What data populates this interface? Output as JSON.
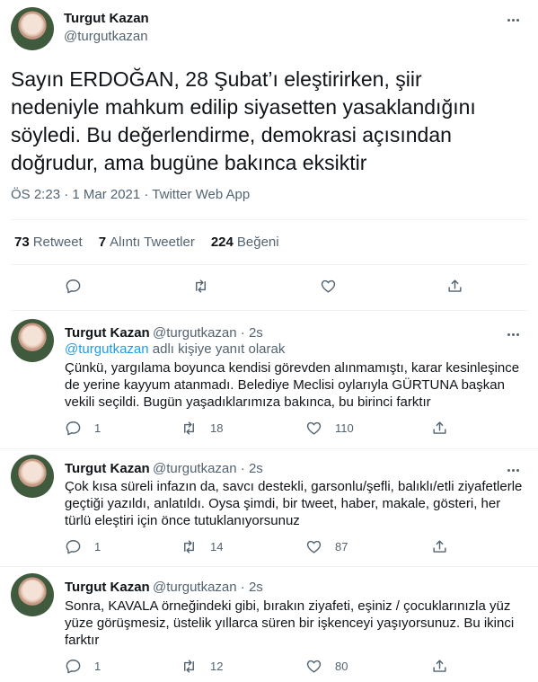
{
  "main": {
    "name": "Turgut Kazan",
    "handle": "@turgutkazan",
    "text": "Sayın ERDOĞAN, 28 Şubat’ı eleştirirken, şiir nedeniyle mahkum edilip siyasetten yasaklandığını söyledi. Bu değerlendirme, demokrasi açısından doğrudur, ama bugüne bakınca eksiktir",
    "meta": "ÖS 2:23 · 1 Mar 2021 · Twitter Web App",
    "stats": {
      "retweet_count": "73",
      "retweet_label": "Retweet",
      "quote_count": "7",
      "quote_label": "Alıntı Tweetler",
      "like_count": "224",
      "like_label": "Beğeni"
    }
  },
  "replies": [
    {
      "name": "Turgut Kazan",
      "handle": "@turgutkazan",
      "time": "· 2s",
      "replying_handle": "@turgutkazan",
      "replying_suffix": " adlı kişiye yanıt olarak",
      "text": "Çünkü, yargılama boyunca kendisi görevden alınmamıştı, karar kesinleşince de yerine kayyum atanmadı. Belediye Meclisi oylarıyla GÜRTUNA başkan vekili seçildi. Bugün yaşadıklarımıza bakınca, bu birinci farktır",
      "replies": "1",
      "retweets": "18",
      "likes": "110"
    },
    {
      "name": "Turgut Kazan",
      "handle": "@turgutkazan",
      "time": "· 2s",
      "text": "Çok kısa süreli infazın da, savcı destekli, garsonlu/şefli, balıklı/etli ziyafetlerle geçtiği yazıldı, anlatıldı. Oysa şimdi, bir tweet, haber, makale, gösteri, her türlü eleştiri için önce tutuklanıyorsunuz",
      "replies": "1",
      "retweets": "14",
      "likes": "87"
    },
    {
      "name": "Turgut Kazan",
      "handle": "@turgutkazan",
      "time": "· 2s",
      "text": "Sonra, KAVALA örneğindeki gibi, bırakın ziyafeti, eşiniz / çocuklarınızla yüz yüze görüşmesiz, üstelik yıllarca süren bir işkenceyi yaşıyorsunuz. Bu ikinci farktır",
      "replies": "1",
      "retweets": "12",
      "likes": "80"
    }
  ],
  "colors": {
    "accent": "#1d9bf0",
    "secondary_text": "#536471",
    "divider": "#eff3f4"
  }
}
